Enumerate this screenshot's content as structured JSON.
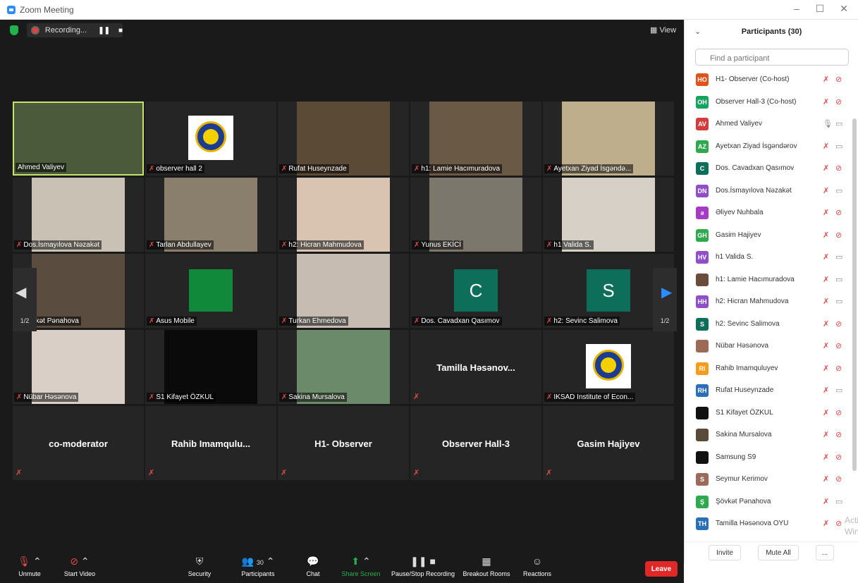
{
  "window": {
    "title": "Zoom Meeting",
    "controls": [
      "–",
      "☐",
      "✕"
    ]
  },
  "topbar": {
    "recording_label": "Recording...",
    "view_label": "View"
  },
  "grid": {
    "page_indicator_left": "1/2",
    "page_indicator_right": "1/2",
    "tiles": [
      {
        "name": "Ahmed Valiyev",
        "kind": "video",
        "active": true,
        "muted": false,
        "bg": "#4a5a3a"
      },
      {
        "name": "observer hall 2",
        "kind": "logo",
        "muted": true,
        "bg": "#ffffff"
      },
      {
        "name": "Rufat Huseynzade",
        "kind": "video",
        "muted": true,
        "bg": "#5b4a35"
      },
      {
        "name": "h1: Lamie Hacımuradova",
        "kind": "video",
        "muted": true,
        "bg": "#6a5a45"
      },
      {
        "name": "Ayetxan Ziyad İsgəndə...",
        "kind": "video",
        "muted": true,
        "bg": "#bfae8c"
      },
      {
        "name": "Dos.İsmayılova Nəzakət",
        "kind": "video",
        "muted": true,
        "bg": "#c9c2b4"
      },
      {
        "name": "Tarlan Abdullayev",
        "kind": "video",
        "muted": true,
        "bg": "#8a7f6c"
      },
      {
        "name": "h2: Hicran Mahmudova",
        "kind": "video",
        "muted": true,
        "bg": "#d8c4b0"
      },
      {
        "name": "Yunus EKİCİ",
        "kind": "video",
        "muted": true,
        "bg": "#7c776c"
      },
      {
        "name": "h1 Valida S.",
        "kind": "video",
        "muted": true,
        "bg": "#d6d0c6"
      },
      {
        "name": "Şövkət Pənahova",
        "kind": "video",
        "muted": true,
        "bg": "#5a4c3f"
      },
      {
        "name": "Asus Mobile",
        "kind": "color",
        "muted": true,
        "bg": "#11893a",
        "initial": ""
      },
      {
        "name": "Turkan Ehmedova",
        "kind": "video",
        "muted": true,
        "bg": "#c6bcb2"
      },
      {
        "name": "Dos. Cavadxan Qasımov",
        "kind": "color",
        "muted": true,
        "bg": "#0d6e5a",
        "initial": "C"
      },
      {
        "name": "h2: Sevinc Salimova",
        "kind": "color",
        "muted": true,
        "bg": "#0d6e5a",
        "initial": "S"
      },
      {
        "name": "Nübar Həsənova",
        "kind": "video",
        "muted": true,
        "bg": "#d9cfc6"
      },
      {
        "name": "S1 Kifayet ÖZKUL",
        "kind": "video",
        "muted": true,
        "bg": "#0a0a0a"
      },
      {
        "name": "Sakina Mursalova",
        "kind": "video",
        "muted": true,
        "bg": "#6a8a6a"
      },
      {
        "name": "",
        "kind": "namecard",
        "muted": true,
        "bigname": "Tamilla Həsənov..."
      },
      {
        "name": "IKSAD Institute of Econ...",
        "kind": "logo",
        "muted": true,
        "bg": "#ffffff"
      },
      {
        "name": "",
        "kind": "namecard",
        "muted": true,
        "bigname": "co-moderator"
      },
      {
        "name": "",
        "kind": "namecard",
        "muted": true,
        "bigname": "Rahib Imamqulu..."
      },
      {
        "name": "",
        "kind": "namecard",
        "muted": true,
        "bigname": "H1- Observer"
      },
      {
        "name": "",
        "kind": "namecard",
        "muted": true,
        "bigname": "Observer Hall-3"
      },
      {
        "name": "",
        "kind": "namecard",
        "muted": true,
        "bigname": "Gasim Hajiyev"
      }
    ]
  },
  "toolbar": {
    "unmute": "Unmute",
    "start_video": "Start Video",
    "security": "Security",
    "participants": "Participants",
    "participants_count": "30",
    "chat": "Chat",
    "share_screen": "Share Screen",
    "pause_stop_recording": "Pause/Stop Recording",
    "breakout_rooms": "Breakout Rooms",
    "reactions": "Reactions",
    "leave": "Leave"
  },
  "panel": {
    "title": "Participants (30)",
    "search_placeholder": "Find a participant",
    "participants": [
      {
        "initials": "HO",
        "color": "#e0541c",
        "name": "H1- Observer (Co-host)",
        "mic": "off",
        "cam": "off"
      },
      {
        "initials": "OH",
        "color": "#16a35f",
        "name": "Observer Hall-3 (Co-host)",
        "mic": "off",
        "cam": "off"
      },
      {
        "initials": "AV",
        "color": "#d43b3b",
        "name": "Ahmed Valiyev",
        "mic": "on",
        "cam": "on"
      },
      {
        "initials": "AZ",
        "color": "#2fa84f",
        "name": "Ayetxan Ziyad İsgəndərov",
        "mic": "off",
        "cam": "on"
      },
      {
        "initials": "C",
        "color": "#0d6e5a",
        "name": "Dos. Cavadxan Qasımov",
        "mic": "off",
        "cam": "off"
      },
      {
        "initials": "DN",
        "color": "#8e4fc9",
        "name": "Dos.İsmayılova Nəzakət",
        "mic": "off",
        "cam": "on"
      },
      {
        "initials": "ə",
        "color": "#a63bc4",
        "name": "Əliyev Nuhbala",
        "mic": "off",
        "cam": "off"
      },
      {
        "initials": "GH",
        "color": "#2fa84f",
        "name": "Gasim Hajiyev",
        "mic": "off",
        "cam": "off"
      },
      {
        "initials": "HV",
        "color": "#8e4fc9",
        "name": "h1 Valida S.",
        "mic": "off",
        "cam": "on"
      },
      {
        "initials": "",
        "color": "#6b4b3b",
        "name": "h1: Lamie Hacımuradova",
        "mic": "off",
        "cam": "on"
      },
      {
        "initials": "HH",
        "color": "#8e4fc9",
        "name": "h2: Hicran Mahmudova",
        "mic": "off",
        "cam": "on"
      },
      {
        "initials": "S",
        "color": "#0d6e5a",
        "name": "h2: Sevinc Salimova",
        "mic": "off",
        "cam": "off"
      },
      {
        "initials": "",
        "color": "#9c6b55",
        "name": "Nübar Həsənova",
        "mic": "off",
        "cam": "off"
      },
      {
        "initials": "RI",
        "color": "#f59c1a",
        "name": "Rahib Imamquluyev",
        "mic": "off",
        "cam": "off"
      },
      {
        "initials": "RH",
        "color": "#2a6fb8",
        "name": "Rufat Huseynzade",
        "mic": "off",
        "cam": "on"
      },
      {
        "initials": "",
        "color": "#111111",
        "name": "S1 Kifayet ÖZKUL",
        "mic": "off",
        "cam": "off"
      },
      {
        "initials": "",
        "color": "#5a4a3a",
        "name": "Sakina Mursalova",
        "mic": "off",
        "cam": "off"
      },
      {
        "initials": "",
        "color": "#111111",
        "name": "Samsung S9",
        "mic": "off",
        "cam": "off"
      },
      {
        "initials": "S",
        "color": "#9b6a5a",
        "name": "Seymur Kerimov",
        "mic": "off",
        "cam": "off"
      },
      {
        "initials": "Ş",
        "color": "#2fa84f",
        "name": "Şövkət Pənahova",
        "mic": "off",
        "cam": "on"
      },
      {
        "initials": "TH",
        "color": "#2a6fb8",
        "name": "Tamilla Həsənova OYU",
        "mic": "off",
        "cam": "off"
      }
    ],
    "invite": "Invite",
    "mute_all": "Mute All",
    "more": "..."
  },
  "watermark": {
    "line1": "Activ",
    "line2": "Windo"
  }
}
